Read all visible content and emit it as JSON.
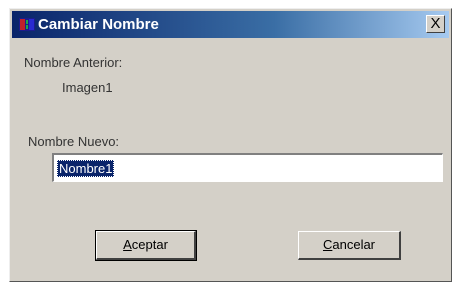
{
  "dialog": {
    "title": "Cambiar Nombre",
    "close_label": "X",
    "old_name_label": "Nombre Anterior:",
    "old_name_value": "Imagen1",
    "new_name_label": "Nombre Nuevo:",
    "new_name_value": "Nombre1",
    "accept_label_mnemonic": "A",
    "accept_label_rest": "ceptar",
    "cancel_label_mnemonic": "C",
    "cancel_label_rest": "ancelar"
  },
  "colors": {
    "title_bar_start": "#0a246a",
    "title_bar_end": "#a6caf0",
    "dialog_face": "#d4d0c8",
    "selection": "#0a246a"
  },
  "icons": {
    "title_icon": "app-window-icon",
    "close_icon": "close-icon"
  }
}
